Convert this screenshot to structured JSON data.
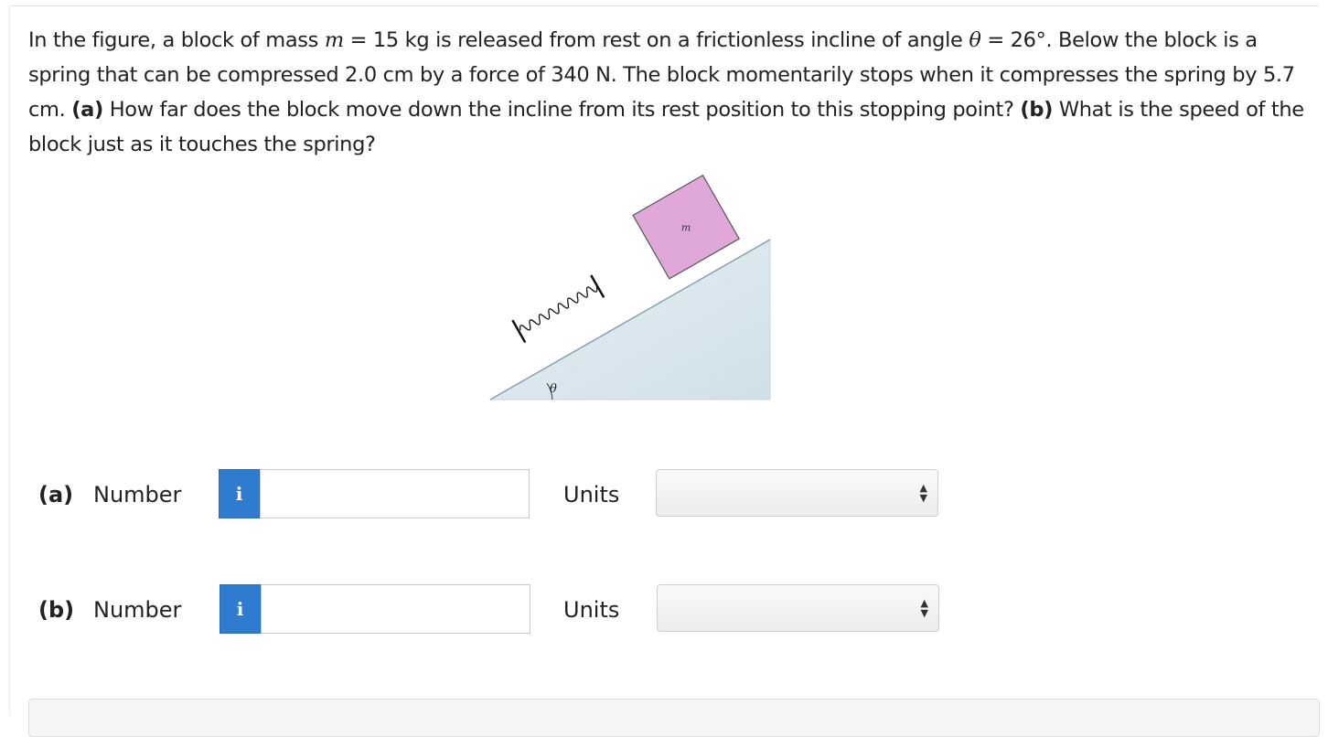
{
  "question": {
    "p1": "In the figure, a block of mass ",
    "m_var": "m",
    "p2": " = 15 kg is released from rest on a frictionless incline of angle ",
    "theta_var": "θ",
    "p3": " = 26°. Below the block is a spring that can be compressed 2.0 cm by a force of 340 N. The block momentarily stops when it compresses the spring by 5.7 cm. ",
    "a_tag": "(a)",
    "a_text": " How far does the block move down the incline from its rest position to this stopping point? ",
    "b_tag": "(b)",
    "b_text": " What is the speed of the block just as it touches the spring?"
  },
  "figure": {
    "block_label": "m",
    "angle_label": "θ",
    "colors": {
      "block": "#dfa8d8",
      "incline": "#dce8ef"
    }
  },
  "answers": [
    {
      "part": "(a)",
      "number_label": "Number",
      "info_icon": "i",
      "value": "",
      "units_label": "Units",
      "units_value": ""
    },
    {
      "part": "(b)",
      "number_label": "Number",
      "info_icon": "i",
      "value": "",
      "units_label": "Units",
      "units_value": ""
    }
  ],
  "colors": {
    "info_button": "#2e7bcf"
  }
}
